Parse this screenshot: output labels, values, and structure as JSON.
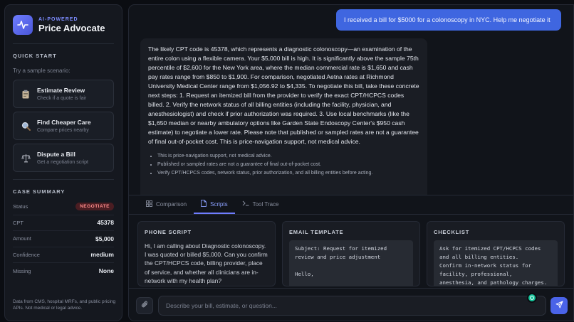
{
  "brand": {
    "kicker": "AI-POWERED",
    "title": "Price Advocate",
    "logo_icon": "pulse-icon",
    "accent": "#6f7dff"
  },
  "quick_start": {
    "title": "QUICK START",
    "subtitle": "Try a sample scenario:",
    "scenarios": [
      {
        "title": "Estimate Review",
        "desc": "Check if a quote is fair",
        "icon": "clipboard-icon"
      },
      {
        "title": "Find Cheaper Care",
        "desc": "Compare prices nearby",
        "icon": "magnifier-icon"
      },
      {
        "title": "Dispute a Bill",
        "desc": "Get a negotiation script",
        "icon": "scales-icon"
      }
    ]
  },
  "case_summary": {
    "title": "CASE SUMMARY",
    "rows": [
      {
        "label": "Status",
        "value": "NEGOTIATE"
      },
      {
        "label": "CPT",
        "value": "45378"
      },
      {
        "label": "Amount",
        "value": "$5,000"
      },
      {
        "label": "Confidence",
        "value": "medium"
      },
      {
        "label": "Missing",
        "value": "None"
      }
    ]
  },
  "footnote": "Data from CMS, hospital MRFs, and public pricing APIs. Not medical or legal advice.",
  "chat": {
    "user_message": "I received a bill for $5000 for a colonoscopy in NYC. Help me negotiate it",
    "assistant_message": "The likely CPT code is 45378, which represents a diagnostic colonoscopy—an examination of the entire colon using a flexible camera. Your $5,000 bill is high. It is significantly above the sample 75th percentile of $2,600 for the New York area, where the median commercial rate is $1,650 and cash pay rates range from $850 to $1,900. For comparison, negotiated Aetna rates at Richmond University Medical Center range from $1,056.92 to $4,335. To negotiate this bill, take these concrete next steps: 1. Request an itemized bill from the provider to verify the exact CPT/HCPCS codes billed. 2. Verify the network status of all billing entities (including the facility, physician, and anesthesiologist) and check if prior authorization was required. 3. Use local benchmarks (like the $1,650 median or nearby ambulatory options like Garden State Endoscopy Center's $950 cash estimate) to negotiate a lower rate. Please note that published or sampled rates are not a guarantee of final out-of-pocket cost. This is price-navigation support, not medical advice.",
    "bullets": [
      "This is price-navigation support, not medical advice.",
      "Published or sampled rates are not a guarantee of final out-of-pocket cost.",
      "Verify CPT/HCPCS codes, network status, prior authorization, and all billing entities before acting."
    ]
  },
  "tabs": [
    {
      "label": "Comparison",
      "icon": "grid-icon"
    },
    {
      "label": "Scripts",
      "icon": "document-icon"
    },
    {
      "label": "Tool Trace",
      "icon": "terminal-icon"
    }
  ],
  "active_tab": "Scripts",
  "cards": {
    "phone": {
      "title": "PHONE SCRIPT",
      "body": "Hi, I am calling about Diagnostic colonoscopy. I was quoted or billed $5,000. Can you confirm the CPT/HCPCS code, billing provider, place of service, and whether all clinicians are in-network with my health plan?"
    },
    "email": {
      "title": "EMAIL TEMPLATE",
      "body": "Subject: Request for itemized\nreview and price adjustment\n\nHello,"
    },
    "checklist": {
      "title": "CHECKLIST",
      "body": "Ask for itemized CPT/HCPCS codes\nand all billing entities.\nConfirm in-network status for\nfacility, professional,\nanesthesia, and pathology charges."
    }
  },
  "composer": {
    "placeholder": "Describe your bill, estimate, or question..."
  }
}
